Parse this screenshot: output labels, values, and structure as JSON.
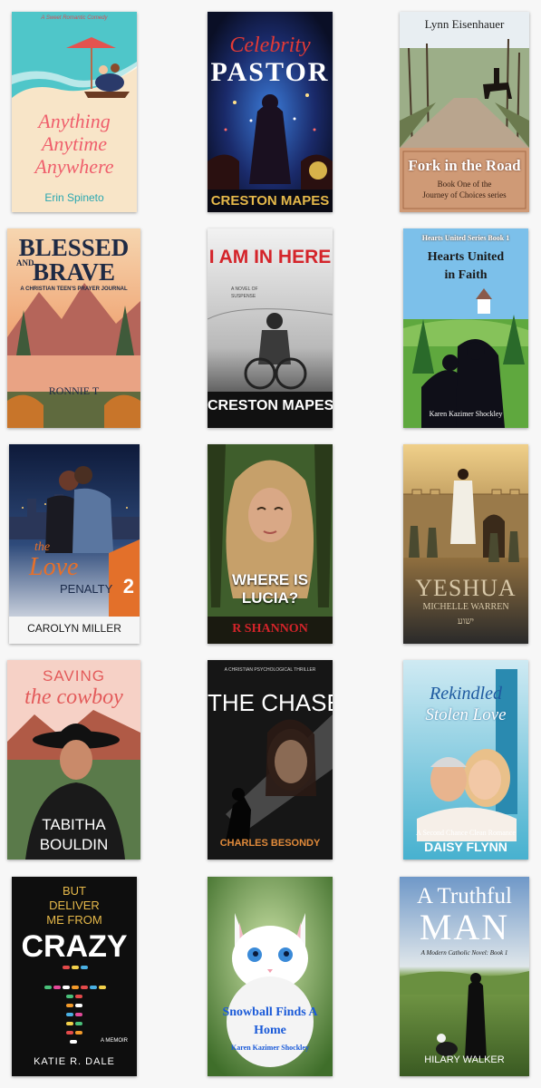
{
  "books": [
    {
      "id": "aaa",
      "tagline": "A Sweet Romantic Comedy",
      "title_l1": "Anything",
      "title_l2": "Anytime",
      "title_l3": "Anywhere",
      "author": "Erin Spineto"
    },
    {
      "id": "cp",
      "title_l1": "Celebrity",
      "title_l2": "PASTOR",
      "badge": "",
      "author": "CRESTON MAPES"
    },
    {
      "id": "fork",
      "author": "Lynn Eisenhauer",
      "title": "Fork in the Road",
      "sub_l1": "Book One of the",
      "sub_l2": "Journey of Choices series"
    },
    {
      "id": "bb",
      "title_l1": "BLESSED",
      "title_l2": "AND",
      "title_l3": "BRAVE",
      "subtitle": "A CHRISTIAN TEEN'S PRAYER JOURNAL",
      "author": "RONNIE T"
    },
    {
      "id": "aih",
      "title": "I AM IN HERE",
      "sub_l1": "A NOVEL OF",
      "sub_l2": "SUSPENSE",
      "author": "CRESTON MAPES"
    },
    {
      "id": "hu",
      "series": "Hearts United Series Book 1",
      "title_l1": "Hearts United",
      "title_l2": "in Faith",
      "author": "Karen Kazimer Shockley"
    },
    {
      "id": "love",
      "title_l1": "the",
      "title_l2": "Love",
      "title_l3": "PENALTY",
      "jersey": "2",
      "author": "CAROLYN MILLER"
    },
    {
      "id": "lucia",
      "title_l1": "WHERE IS",
      "title_l2": "LUCIA?",
      "author": "R SHANNON"
    },
    {
      "id": "yeshua",
      "title": "YESHUA",
      "author": "MICHELLE WARREN",
      "hebrew": "ישוע"
    },
    {
      "id": "cowboy",
      "title_l1": "SAVING",
      "title_l2": "the cowboy",
      "author_l1": "TABITHA",
      "author_l2": "BOULDIN"
    },
    {
      "id": "chase",
      "genre": "A CHRISTIAN PSYCHOLOGICAL THRILLER",
      "title": "THE CHASE",
      "author": "CHARLES BESONDY"
    },
    {
      "id": "rekindled",
      "title_l1": "Rekindled",
      "title_l2": "Stolen Love",
      "subtitle": "A Second Chance Clean Romance",
      "author": "DAISY FLYNN"
    },
    {
      "id": "crazy",
      "title_l1": "BUT",
      "title_l2": "DELIVER",
      "title_l3": "ME FROM",
      "title_l4": "CRAZY",
      "memoir": "A MEMOIR",
      "author": "KATIE R. DALE"
    },
    {
      "id": "snowball",
      "title_l1": "Snowball Finds A",
      "title_l2": "Home",
      "author": "Karen Kazimer Shockley"
    },
    {
      "id": "truthful",
      "title_l1": "A Truthful",
      "title_l2": "MAN",
      "subtitle": "A Modern Catholic Novel: Book 1",
      "author": "HILARY WALKER"
    }
  ],
  "colors": {
    "page_bg": "#f7f7f7",
    "pink": "#ef5f6c",
    "red": "#d4242a",
    "gold": "#e6b94a"
  }
}
